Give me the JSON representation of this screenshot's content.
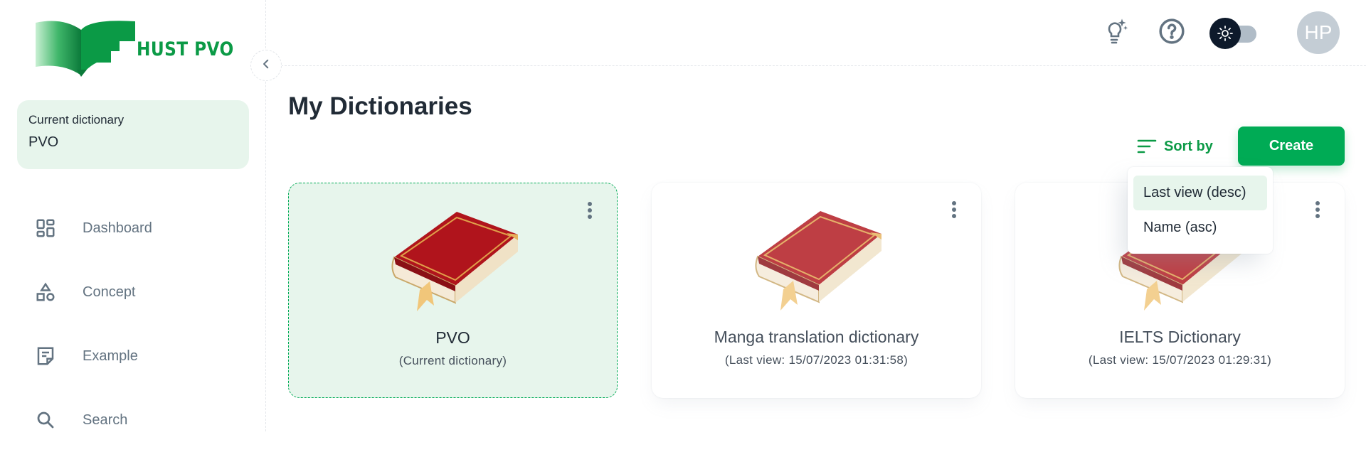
{
  "app": {
    "logo_text": "HUST PVO",
    "brand_color": "#00ab55"
  },
  "sidebar": {
    "current_dictionary": {
      "label": "Current dictionary",
      "value": "PVO"
    },
    "items": [
      {
        "label": "Dashboard",
        "icon": "dashboard-icon"
      },
      {
        "label": "Concept",
        "icon": "shapes-icon"
      },
      {
        "label": "Example",
        "icon": "note-icon"
      },
      {
        "label": "Search",
        "icon": "search-icon"
      }
    ]
  },
  "header": {
    "icons": [
      "lightbulb-sparkle-icon",
      "help-icon",
      "theme-toggle-icon"
    ],
    "avatar_initials": "HP"
  },
  "main": {
    "title": "My Dictionaries",
    "sort_label": "Sort by",
    "create_label": "Create",
    "sort_menu": {
      "options": [
        "Last view (desc)",
        "Name (asc)"
      ],
      "selected": "Last view (desc)"
    },
    "dictionaries": [
      {
        "name": "PVO",
        "subtitle": "(Current dictionary)",
        "current": true
      },
      {
        "name": "Manga translation dictionary",
        "subtitle": "(Last view: 15/07/2023 01:31:58)",
        "current": false
      },
      {
        "name": "IELTS Dictionary",
        "subtitle": "(Last view: 15/07/2023 01:29:31)",
        "current": false
      }
    ]
  }
}
